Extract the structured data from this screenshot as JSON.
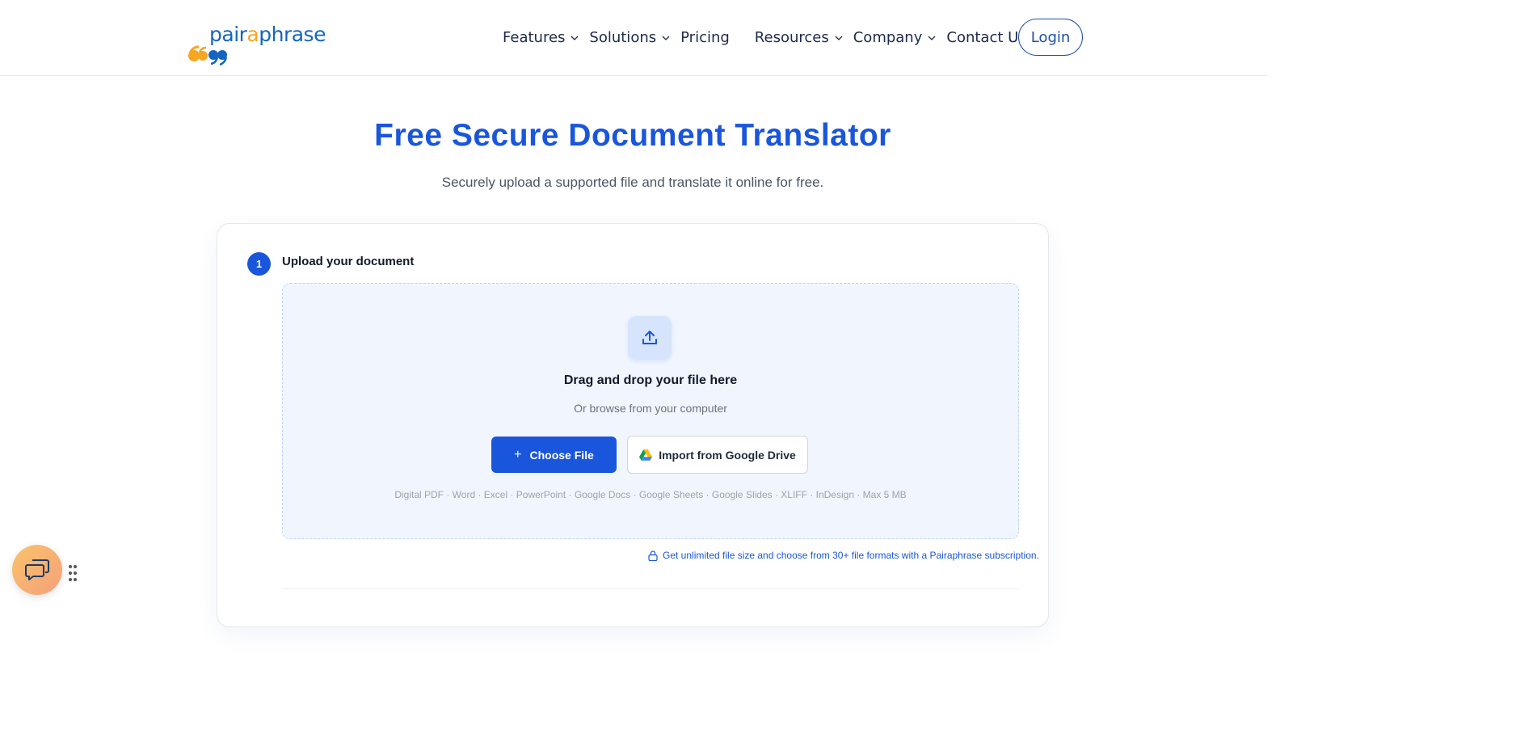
{
  "brand": {
    "logo_text_part1": "pair",
    "logo_text_accent": "a",
    "logo_text_part2": "phrase",
    "primary_color": "#1a56db",
    "accent_color": "#f5a623"
  },
  "nav": {
    "items": [
      {
        "label": "Features",
        "has_dropdown": true
      },
      {
        "label": "Solutions",
        "has_dropdown": true
      },
      {
        "label": "Pricing",
        "has_dropdown": false
      },
      {
        "label": "Resources",
        "has_dropdown": true
      },
      {
        "label": "Company",
        "has_dropdown": true
      },
      {
        "label": "Contact Us",
        "has_dropdown": false
      }
    ],
    "login_label": "Login"
  },
  "hero": {
    "title": "Free Secure Document Translator",
    "subtitle": "Securely upload a supported file and translate it online for free."
  },
  "step1": {
    "number": "1",
    "label": "Upload your document"
  },
  "dropzone": {
    "icon": "upload-icon",
    "title": "Drag and drop your file here",
    "subtitle": "Or browse from your computer",
    "choose_file_label": "Choose File",
    "google_drive_label": "Import from Google Drive",
    "formats": "Digital PDF · Word · Excel · PowerPoint · Google Docs · Google Sheets · Google Slides · XLIFF · InDesign · Max 5 MB"
  },
  "subscription_note": "Get unlimited file size and choose from 30+ file formats with a Pairaphrase subscription.",
  "chat_widget": {
    "icon": "chat-bubbles-icon"
  }
}
